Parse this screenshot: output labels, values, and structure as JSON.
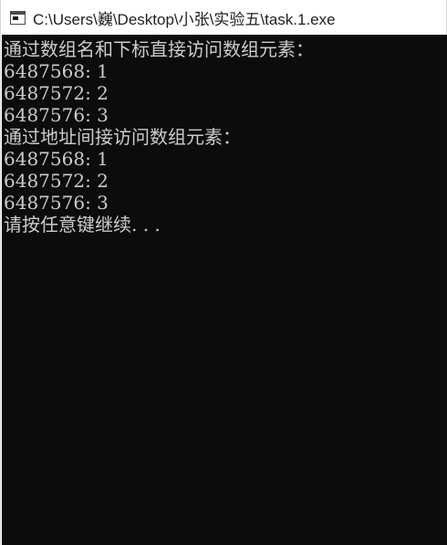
{
  "window": {
    "title": "C:\\Users\\巍\\Desktop\\小张\\实验五\\task.1.exe",
    "icon": "console-app-icon"
  },
  "console": {
    "lines": [
      "通过数组名和下标直接访问数组元素：",
      "6487568: 1",
      "6487572: 2",
      "6487576: 3",
      "通过地址间接访问数组元素：",
      "6487568: 1",
      "6487572: 2",
      "6487576: 3",
      "请按任意键继续. . ."
    ],
    "background_color": "#0c0c0c",
    "text_color": "#cccccc"
  }
}
